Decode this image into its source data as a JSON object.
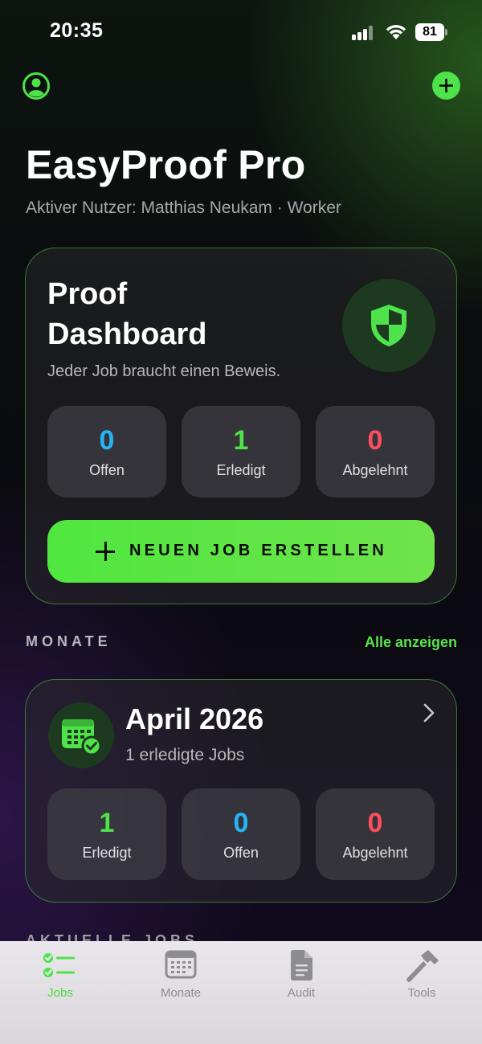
{
  "status_bar": {
    "time": "20:35",
    "battery": "81"
  },
  "header": {
    "app_title": "EasyProof Pro",
    "active_user": "Aktiver Nutzer: Matthias Neukam · Worker"
  },
  "dashboard": {
    "title": "Proof Dashboard",
    "subtitle": "Jeder Job braucht einen Beweis.",
    "stats": [
      {
        "value": "0",
        "label": "Offen",
        "color": "#27b6f5"
      },
      {
        "value": "1",
        "label": "Erledigt",
        "color": "#4ee34a"
      },
      {
        "value": "0",
        "label": "Abgelehnt",
        "color": "#ff4d5e"
      }
    ],
    "new_job_label": "NEUEN JOB ERSTELLEN"
  },
  "months_section": {
    "heading": "MONATE",
    "show_all": "Alle anzeigen",
    "card": {
      "title": "April 2026",
      "subtitle": "1 erledigte Jobs",
      "stats": [
        {
          "value": "1",
          "label": "Erledigt",
          "color": "#4ee34a"
        },
        {
          "value": "0",
          "label": "Offen",
          "color": "#27b6f5"
        },
        {
          "value": "0",
          "label": "Abgelehnt",
          "color": "#ff4d5e"
        }
      ]
    }
  },
  "current_jobs_heading": "AKTUELLE JOBS",
  "tab_bar": {
    "tabs": [
      {
        "label": "Jobs",
        "icon": "checklist-icon",
        "active": true
      },
      {
        "label": "Monate",
        "icon": "calendar-icon",
        "active": false
      },
      {
        "label": "Audit",
        "icon": "document-icon",
        "active": false
      },
      {
        "label": "Tools",
        "icon": "hammer-icon",
        "active": false
      }
    ]
  },
  "colors": {
    "accent": "#4ee34a",
    "open": "#27b6f5",
    "done": "#4ee34a",
    "rejected": "#ff4d5e"
  }
}
